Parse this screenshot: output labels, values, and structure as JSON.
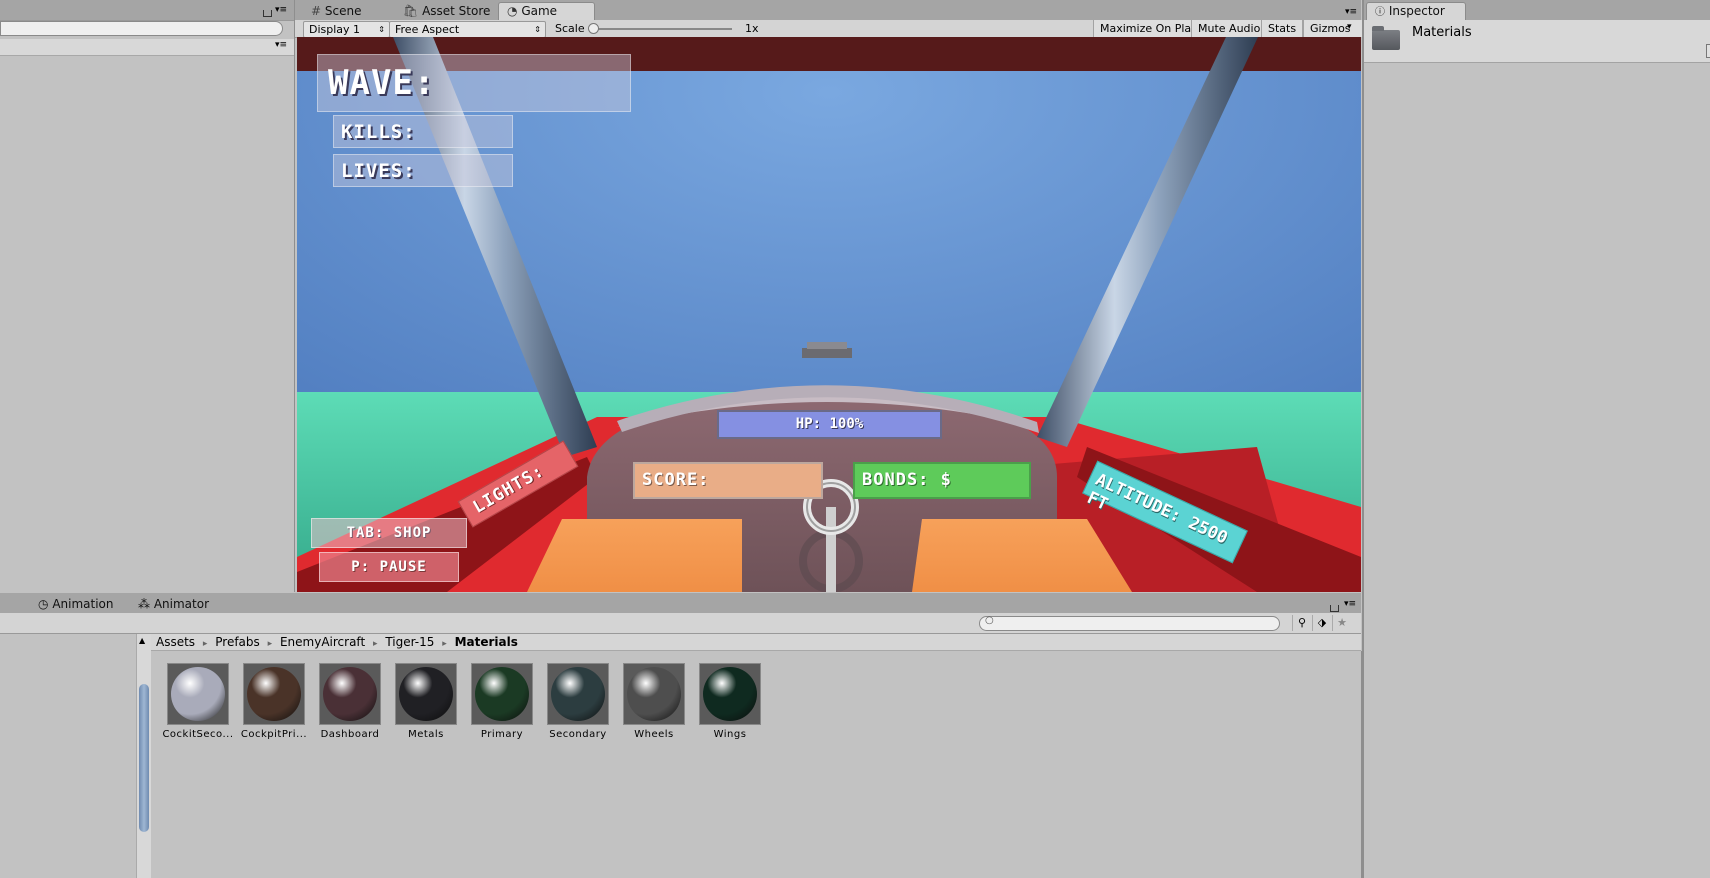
{
  "game_tabs": [
    {
      "label": "Scene",
      "icon": "hash-icon"
    },
    {
      "label": "Asset Store",
      "icon": "store-icon"
    },
    {
      "label": "Game",
      "icon": "pacman-icon"
    }
  ],
  "game_toolbar": {
    "display": "Display 1",
    "aspect": "Free Aspect",
    "scale_label": "Scale",
    "scale_value": "1x",
    "maximize": "Maximize On Play",
    "mute": "Mute Audio",
    "stats": "Stats",
    "gizmos": "Gizmos"
  },
  "hud": {
    "wave": "WAVE:",
    "kills": "KILLS:",
    "lives": "LIVES:",
    "hp": "HP: 100%",
    "score": "SCORE:",
    "bonds": "BONDS: $",
    "lights": "LIGHTS:",
    "altitude": "ALTITUDE: 2500 FT",
    "shop": "TAB: SHOP",
    "pause": "P: PAUSE"
  },
  "inspector": {
    "tab": "Inspector",
    "asset_name": "Materials"
  },
  "bottom_tabs": [
    {
      "label": "Animation",
      "icon": "clock-icon"
    },
    {
      "label": "Animator",
      "icon": "animator-icon"
    }
  ],
  "breadcrumb": [
    "Assets",
    "Prefabs",
    "EnemyAircraft",
    "Tiger-15",
    "Materials"
  ],
  "materials": [
    {
      "label": "CockitSeco...",
      "color": "#a9abba"
    },
    {
      "label": "CockpitPri...",
      "color": "#4a3328"
    },
    {
      "label": "Dashboard",
      "color": "#4a3036"
    },
    {
      "label": "Metals",
      "color": "#202024"
    },
    {
      "label": "Primary",
      "color": "#1b3a24"
    },
    {
      "label": "Secondary",
      "color": "#2c3d40"
    },
    {
      "label": "Wheels",
      "color": "#4e4e4e"
    },
    {
      "label": "Wings",
      "color": "#0f2a20"
    }
  ]
}
